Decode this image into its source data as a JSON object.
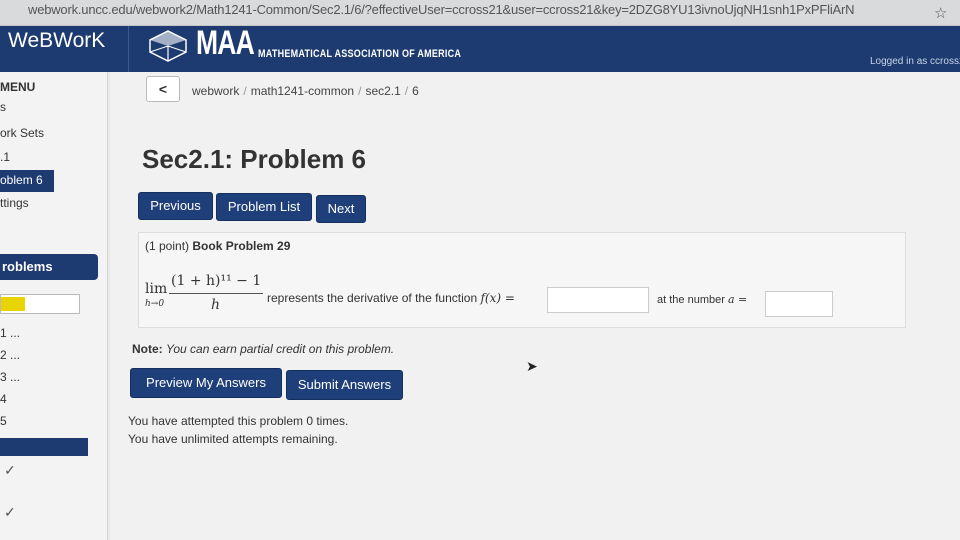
{
  "browser": {
    "url": "webwork.uncc.edu/webwork2/Math1241-Common/Sec2.1/6/?effectiveUser=ccross21&user=ccross21&key=2DZG8YU13ivnoUjqNH1snh1PxPFliArN",
    "star_icon": "star-icon"
  },
  "header": {
    "brand": "WeBWorK",
    "maa_word": "MAA",
    "maa_full": "MATHEMATICAL ASSOCIATION OF AMERICA",
    "logged_in": "Logged in as ccross2"
  },
  "sidebar": {
    "menu_label": "MENU",
    "links": [
      "s",
      "ork Sets",
      ".1"
    ],
    "active_link": "oblem 6",
    "settings_link": "ttings",
    "problems_label": "roblems",
    "progress_fraction": 0.31,
    "problem_items": [
      "1 ...",
      "2 ...",
      "3 ...",
      "4",
      "5"
    ],
    "checks": [
      "✓",
      "✓"
    ]
  },
  "breadcrumb": {
    "back_label": "<",
    "parts": [
      "webwork",
      "math1241-common",
      "sec2.1",
      "6"
    ]
  },
  "problem": {
    "title": "Sec2.1: Problem 6",
    "buttons": {
      "previous": "Previous",
      "list": "Problem List",
      "next": "Next"
    },
    "points": "(1 point)",
    "book_ref": "Book Problem 29",
    "lim": "lim",
    "lim_sub": "h→0",
    "numerator": "(1 + h)¹¹ − 1",
    "denominator": "h",
    "text_represents": "represents the derivative of the function",
    "fx": "f(x) =",
    "text_at": "at the number",
    "a_eq": "a =",
    "answer1_value": "",
    "answer2_value": ""
  },
  "note": {
    "label": "Note:",
    "text": "You can earn partial credit on this problem."
  },
  "actions": {
    "preview": "Preview My Answers",
    "submit": "Submit Answers"
  },
  "status": {
    "attempted": "You have attempted this problem 0 times.",
    "remaining": "You have unlimited attempts remaining."
  },
  "colors": {
    "header_bg": "#1d3b70",
    "button_bg": "#1f3f7a",
    "progress_fill": "#e8d400"
  }
}
